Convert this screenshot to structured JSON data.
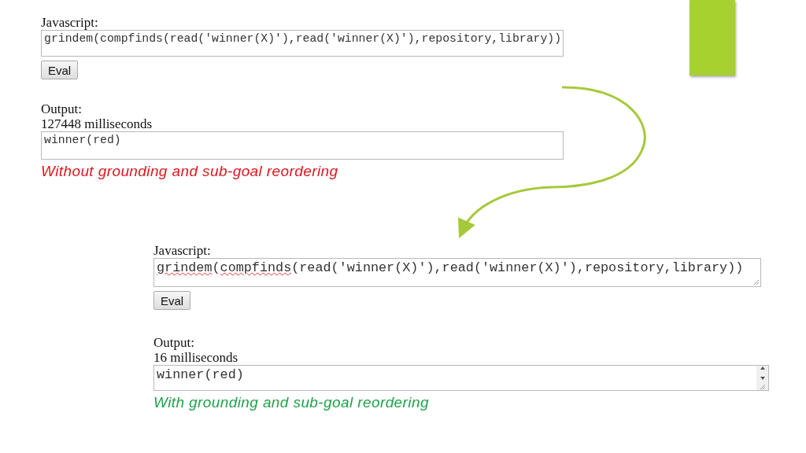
{
  "panels": [
    {
      "label": "Javascript:",
      "code": "grindem(compfinds(read('winner(X)'),read('winner(X)'),repository,library))",
      "spellcheck_marked": false,
      "button": "Eval",
      "output_label": "Output:",
      "time": "127448 milliseconds",
      "output": "winner(red)",
      "caption": "Without grounding and sub-goal reordering",
      "color": "#e0161e"
    },
    {
      "label": "Javascript:",
      "code": "grindem(compfinds(read('winner(X)'),read('winner(X)'),repository,library))",
      "spellcheck_marked": true,
      "button": "Eval",
      "output_label": "Output:",
      "time": "16 milliseconds",
      "output": "winner(red)",
      "caption": "With grounding and sub-goal reordering",
      "color": "#1fa34a"
    }
  ]
}
